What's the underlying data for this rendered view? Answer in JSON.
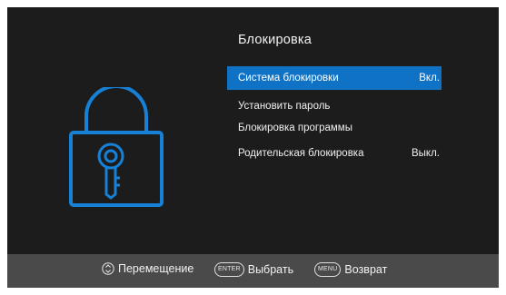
{
  "menu": {
    "title": "Блокировка",
    "items": [
      {
        "label": "Система блокировки",
        "value": "Вкл.",
        "selected": true
      },
      {
        "label": "Установить пароль",
        "value": ""
      },
      {
        "label": "Блокировка программы",
        "value": ""
      },
      {
        "label": "Родительская блокировка",
        "value": "Выкл."
      }
    ]
  },
  "footer": {
    "navigate_label": "Перемещение",
    "enter_key": "ENTER",
    "select_label": "Выбрать",
    "menu_key": "MENU",
    "back_label": "Возврат"
  },
  "icons": {
    "main": "padlock-with-key-icon",
    "navigate": "up-down-arrows-icon"
  },
  "colors": {
    "background": "#1c1c1c",
    "selection": "#0f72c4",
    "lock_icon": "#1681d6",
    "footer": "#4a4a4a"
  }
}
